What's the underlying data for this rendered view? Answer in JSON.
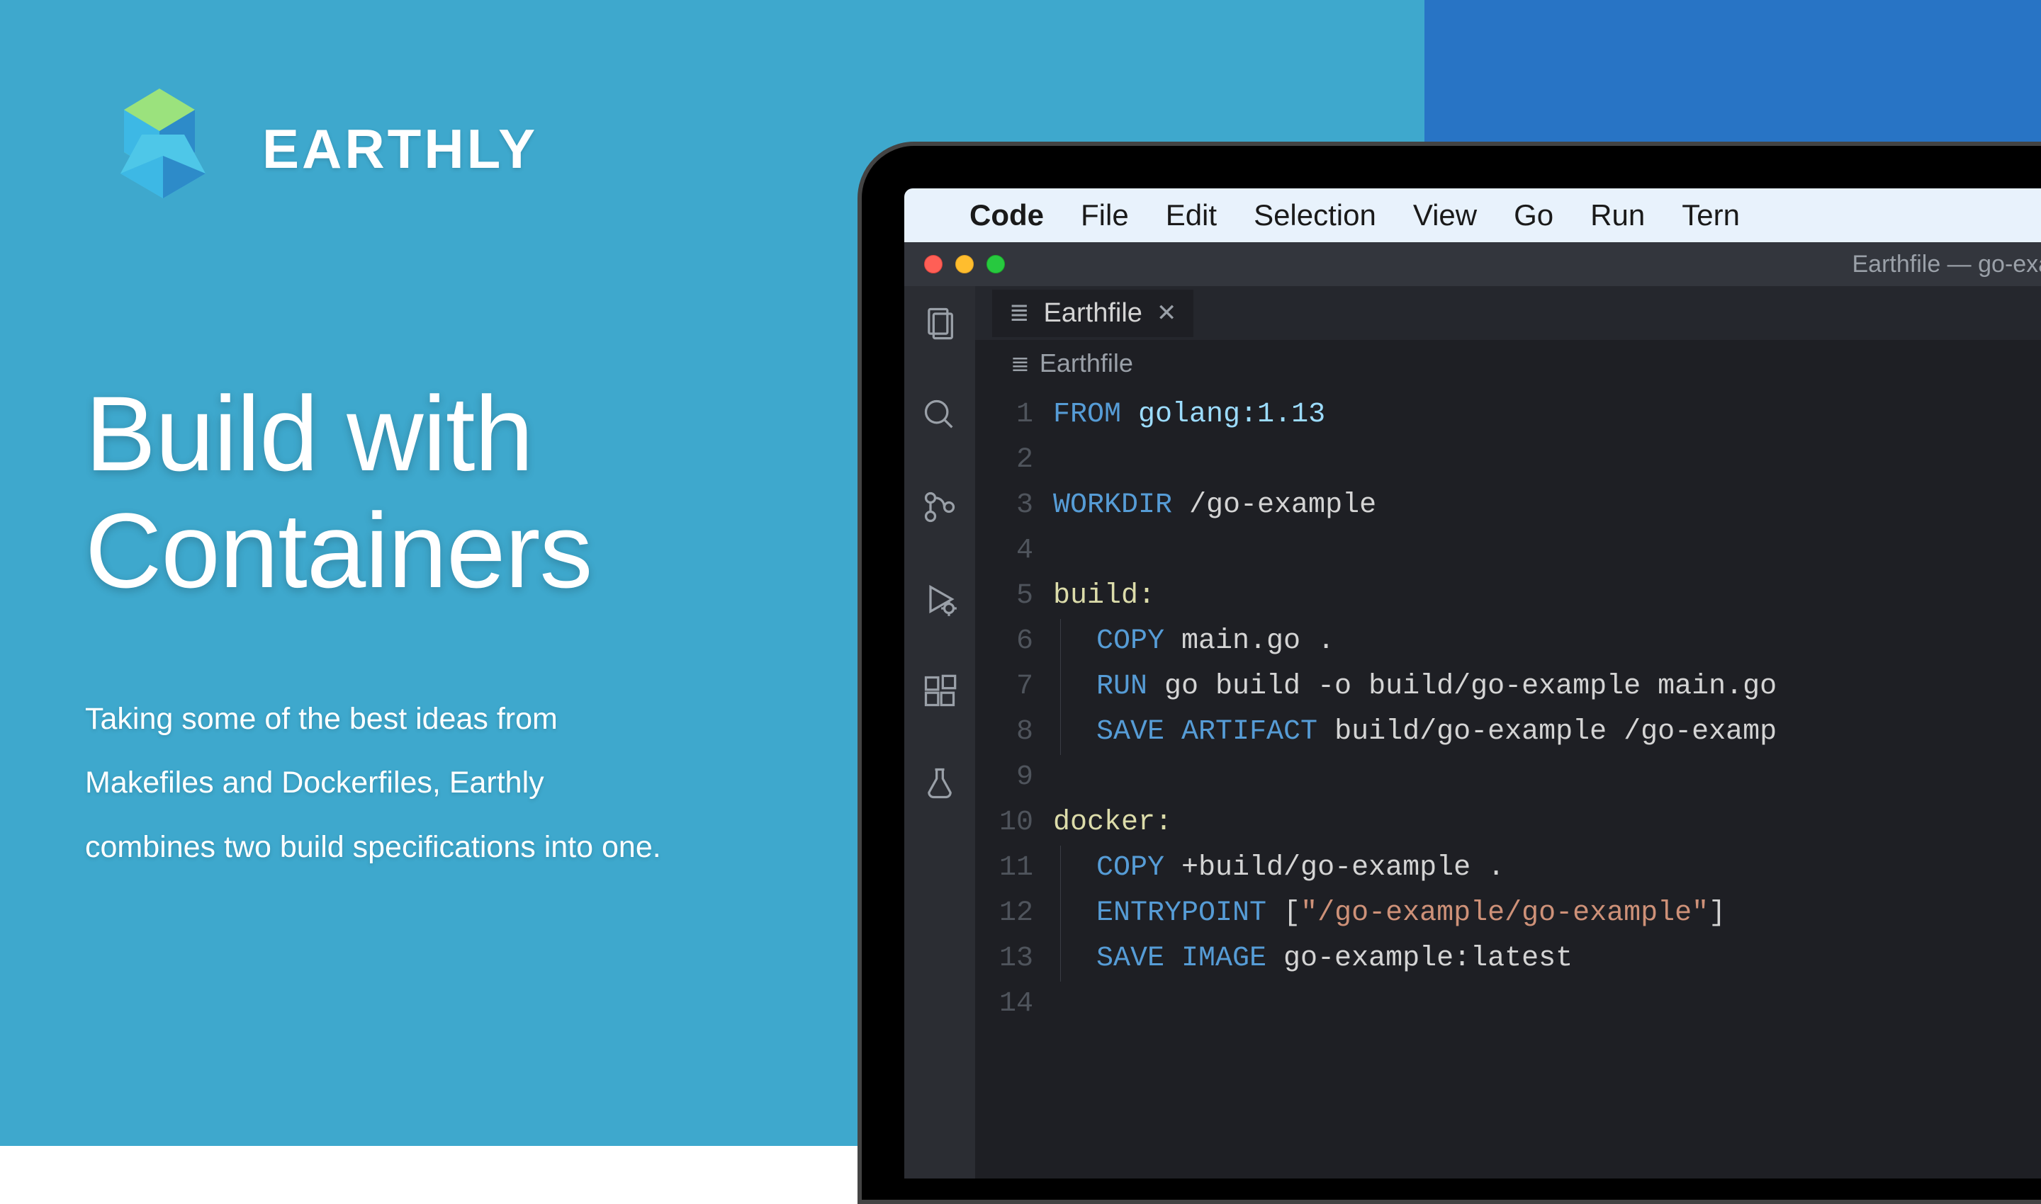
{
  "brand": {
    "name": "EARTHLY"
  },
  "headline": "Build with Containers",
  "subtext": "Taking some of the best ideas from Makefiles and Dockerfiles, Earthly combines two build specifications into one.",
  "menubar": {
    "app": "Code",
    "items": [
      "File",
      "Edit",
      "Selection",
      "View",
      "Go",
      "Run",
      "Tern"
    ]
  },
  "window": {
    "title": "Earthfile — go-exan"
  },
  "tab": {
    "name": "Earthfile"
  },
  "breadcrumb": {
    "name": "Earthfile"
  },
  "code": {
    "lines": [
      {
        "n": 1,
        "segments": [
          [
            "kw-blue",
            "FROM "
          ],
          [
            "kw-teal",
            "golang:1.13"
          ]
        ]
      },
      {
        "n": 2,
        "segments": []
      },
      {
        "n": 3,
        "segments": [
          [
            "kw-blue",
            "WORKDIR "
          ],
          [
            "kw-white",
            "/go-example"
          ]
        ]
      },
      {
        "n": 4,
        "segments": []
      },
      {
        "n": 5,
        "segments": [
          [
            "kw-yellow",
            "build:"
          ]
        ]
      },
      {
        "n": 6,
        "indent": true,
        "segments": [
          [
            "kw-blue",
            "COPY "
          ],
          [
            "kw-white",
            "main.go ."
          ]
        ]
      },
      {
        "n": 7,
        "indent": true,
        "segments": [
          [
            "kw-blue",
            "RUN "
          ],
          [
            "kw-white",
            "go build -o build/go-example main.go"
          ]
        ]
      },
      {
        "n": 8,
        "indent": true,
        "segments": [
          [
            "kw-blue",
            "SAVE ARTIFACT "
          ],
          [
            "kw-white",
            "build/go-example /go-examp"
          ]
        ]
      },
      {
        "n": 9,
        "segments": []
      },
      {
        "n": 10,
        "segments": [
          [
            "kw-yellow",
            "docker:"
          ]
        ]
      },
      {
        "n": 11,
        "indent": true,
        "segments": [
          [
            "kw-blue",
            "COPY "
          ],
          [
            "kw-white",
            "+build/go-example ."
          ]
        ]
      },
      {
        "n": 12,
        "indent": true,
        "segments": [
          [
            "kw-blue",
            "ENTRYPOINT "
          ],
          [
            "kw-white",
            "["
          ],
          [
            "kw-orange",
            "\"/go-example/go-example\""
          ],
          [
            "kw-white",
            "]"
          ]
        ]
      },
      {
        "n": 13,
        "indent": true,
        "segments": [
          [
            "kw-blue",
            "SAVE IMAGE "
          ],
          [
            "kw-white",
            "go-example:latest"
          ]
        ]
      },
      {
        "n": 14,
        "segments": []
      }
    ]
  }
}
